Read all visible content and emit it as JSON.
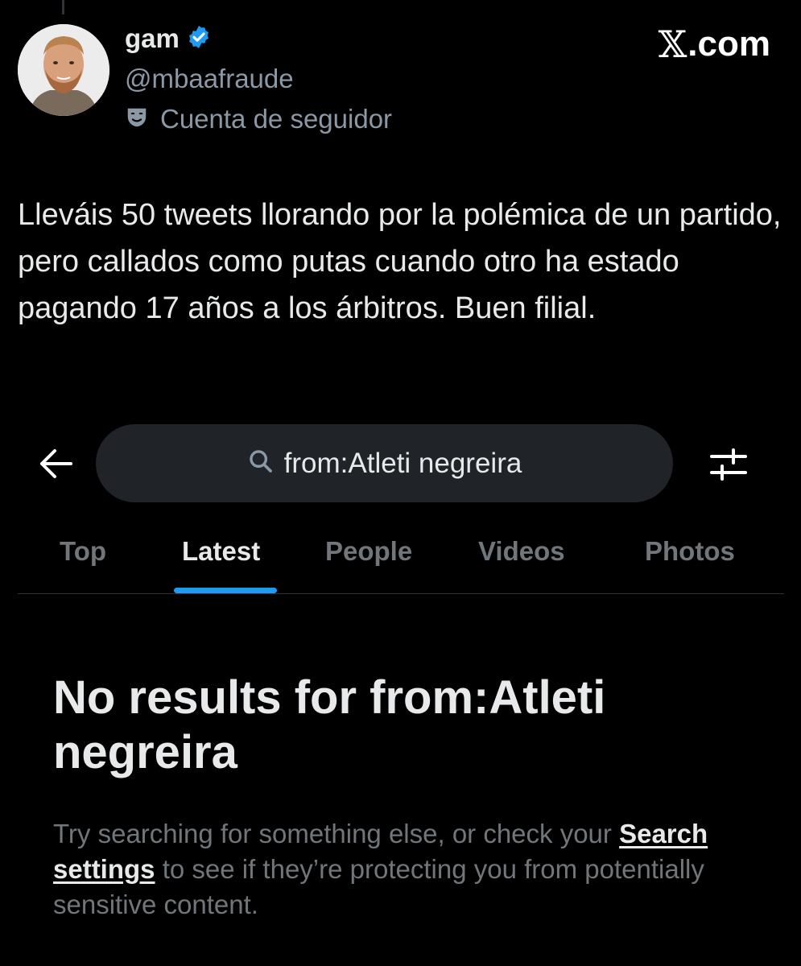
{
  "author": {
    "display_name": "gam",
    "handle": "@mbaafraude",
    "account_label": "Cuenta de seguidor",
    "verified_color": "#1d9bf0"
  },
  "brand": {
    "mark": "𝕏",
    "domain": ".com"
  },
  "tweet": {
    "text": "Lleváis 50 tweets llorando por la polémica de un partido, pero callados como putas cuando otro ha estado pagando 17 años a los árbitros. Buen filial."
  },
  "search": {
    "query": "from:Atleti negreira",
    "tabs": [
      {
        "label": "Top",
        "active": false
      },
      {
        "label": "Latest",
        "active": true
      },
      {
        "label": "People",
        "active": false
      },
      {
        "label": "Videos",
        "active": false
      },
      {
        "label": "Photos",
        "active": false
      }
    ],
    "accent": "#1d9bf0"
  },
  "empty_state": {
    "title": "No results for from:Atleti negreira",
    "desc_before": "Try searching for something else, or check your ",
    "link": "Search settings",
    "desc_after": " to see if they’re protecting you from potentially sensitive content."
  }
}
